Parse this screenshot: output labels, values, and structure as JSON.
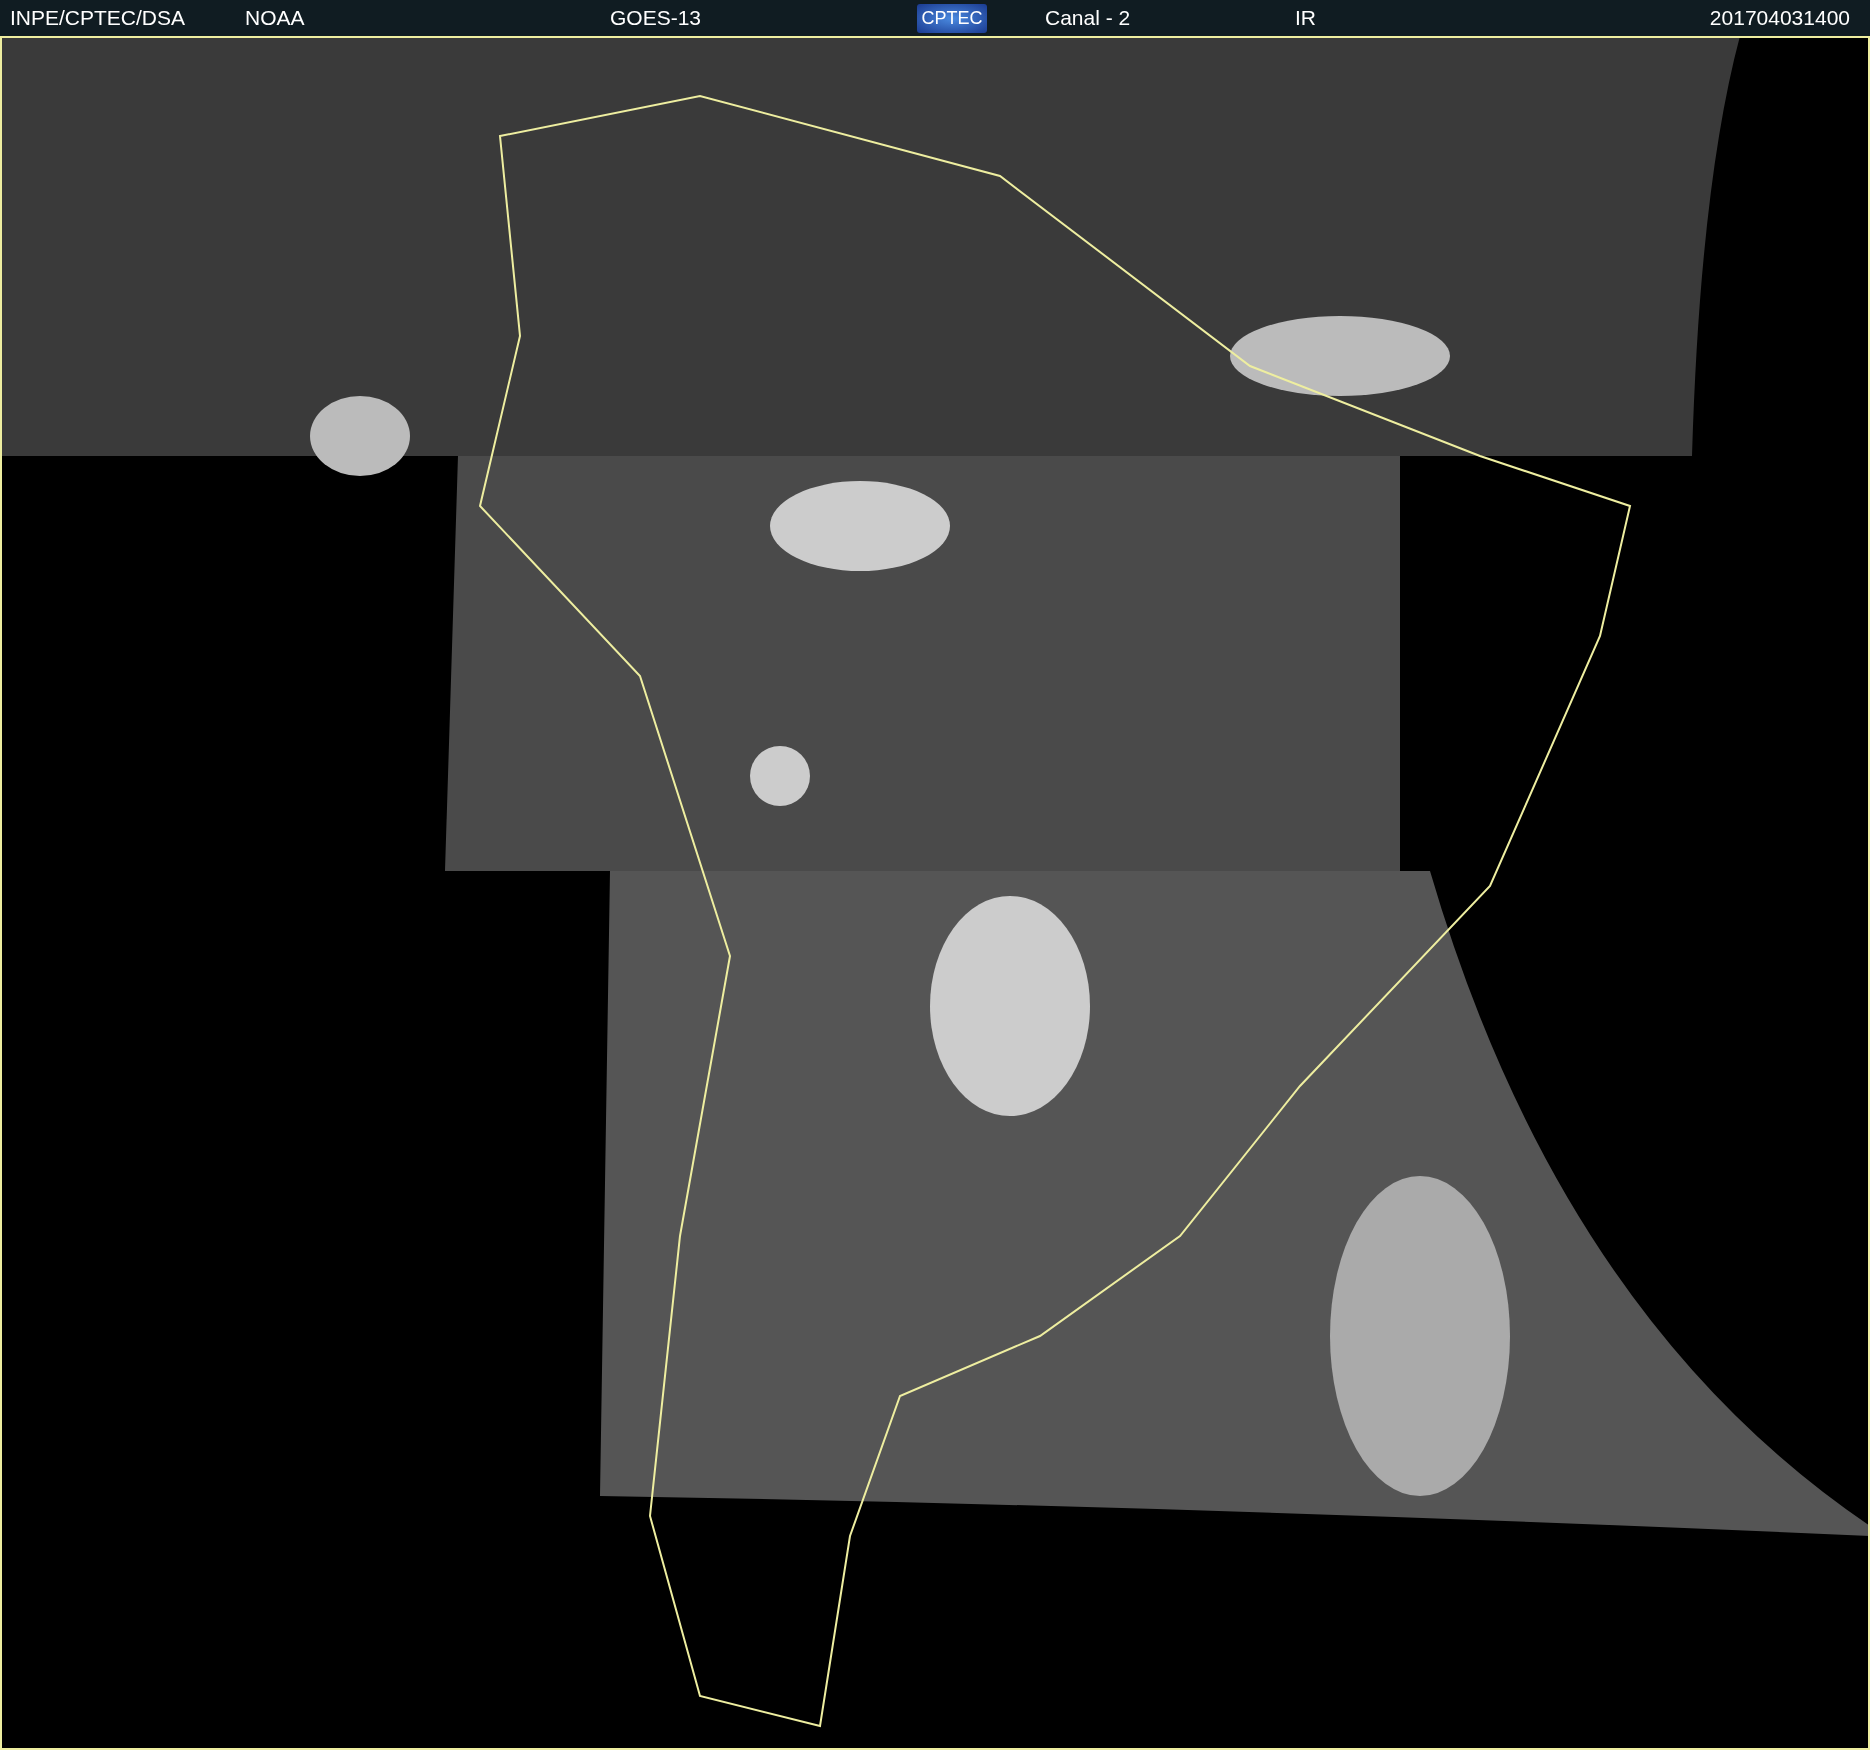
{
  "header": {
    "items": [
      {
        "kind": "text",
        "text": "INPE/CPTEC/DSA"
      },
      {
        "kind": "text",
        "text": "NOAA"
      },
      {
        "kind": "text",
        "text": "GOES-13"
      },
      {
        "kind": "logo",
        "text": "CPTEC"
      },
      {
        "kind": "text",
        "text": "Canal - 2"
      },
      {
        "kind": "text",
        "text": "IR"
      },
      {
        "kind": "text",
        "text": "201704031400"
      }
    ]
  }
}
